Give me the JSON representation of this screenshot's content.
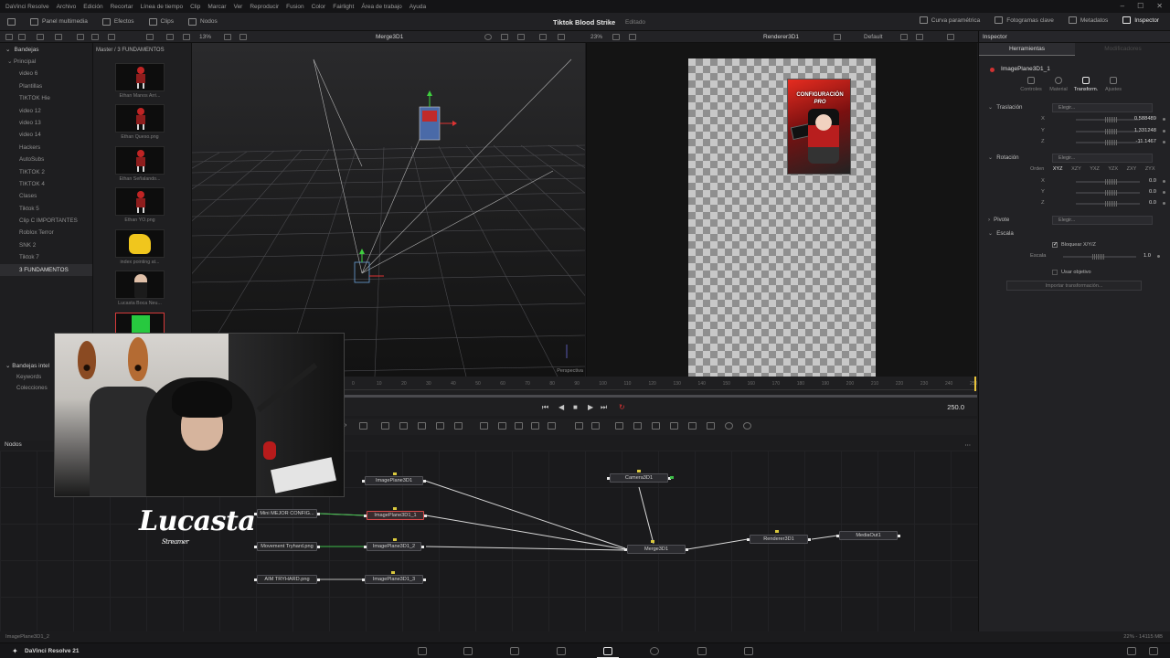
{
  "app": {
    "name": "DaVinci Resolve",
    "menu": [
      "Archivo",
      "Edición",
      "Recortar",
      "Línea de tiempo",
      "Clip",
      "Marcar",
      "Ver",
      "Reproducir",
      "Fusion",
      "Color",
      "Fairlight",
      "Área de trabajo",
      "Ayuda"
    ],
    "project_title": "Tiktok Blood Strike",
    "project_status": "Editado",
    "bottom_label": "DaVinci Resolve 21"
  },
  "toolbar": {
    "media_pool": "Panel multimedia",
    "effects": "Efectos",
    "clips": "Clips",
    "nodes": "Nodos",
    "curve": "Curva paramétrica",
    "keyframes": "Fotogramas clave",
    "metadata": "Metadatos",
    "inspector": "Inspector"
  },
  "viewer_bar": {
    "zoom_left": "13%",
    "left_title": "Merge3D1",
    "zoom_right": "23%",
    "right_title": "Renderer3D1",
    "preset": "Default",
    "inspector_label": "Inspector"
  },
  "bins": {
    "header": "Bandejas",
    "root": "Principal",
    "items": [
      "video 6",
      "Plantillas",
      "TIKTOK Hie",
      "video 12",
      "video 13",
      "video 14",
      "Hackers",
      "AutoSubs",
      "TIKTOK 2",
      "TIKTOK 4",
      "Clases",
      "Tiktok 5",
      "Clip C IMPORTANTES",
      "Roblox Terror",
      "SNK 2",
      "Tiktok 7",
      "3 FUNDAMENTOS"
    ],
    "selected": "3 FUNDAMENTOS",
    "smart_header": "Bandejas intel",
    "smart_items": [
      "Keywords",
      "Colecciones"
    ]
  },
  "media": {
    "path": "Master / 3 FUNDAMENTOS",
    "clips": [
      "Ethan Manos Arri...",
      "Ethan Queso.png",
      "Ethan Señalando...",
      "Ethan YO.png",
      "index pointing at...",
      "Lucasta Boca Neu...",
      ""
    ]
  },
  "viewer_left": {
    "label": "Perspectiva"
  },
  "viewer_right": {
    "thumbnail_line1": "CONFIGURACIÓN",
    "thumbnail_line2": "PRO"
  },
  "inspector": {
    "tab_tools": "Herramientas",
    "tab_modifiers": "Modificadores",
    "node_name": "ImagePlane3D1_1",
    "subtabs": [
      "Controles",
      "Material",
      "Transform.",
      "Ajustes"
    ],
    "active_subtab": "Transform.",
    "translation": {
      "label": "Traslación",
      "choose": "Elegir...",
      "x": "0.588489",
      "y": "1.331248",
      "z": "-11.1467"
    },
    "rotation": {
      "label": "Rotación",
      "choose": "Elegir...",
      "order_label": "Orden",
      "orders": [
        "XYZ",
        "XZY",
        "YXZ",
        "YZX",
        "ZXY",
        "ZYX"
      ],
      "x": "0.0",
      "y": "0.0",
      "z": "0.0"
    },
    "pivot": {
      "label": "Pivote",
      "choose": "Elegir..."
    },
    "scale": {
      "label": "Escala",
      "lock": "Bloquear X/Y/Z",
      "scale_label": "Escala",
      "value": "1.0"
    },
    "target": "Usar objetivo",
    "import": "Importar transformación..."
  },
  "timeline": {
    "ticks": [
      "0",
      "10",
      "20",
      "30",
      "40",
      "50",
      "60",
      "70",
      "80",
      "90",
      "100",
      "110",
      "120",
      "130",
      "140",
      "150",
      "160",
      "170",
      "180",
      "190",
      "200",
      "210",
      "220",
      "230",
      "240",
      "250"
    ],
    "end_frame": "250.0"
  },
  "nodes": {
    "header": "Nodos",
    "list": [
      {
        "id": "imgplane",
        "label": "ImagePlane3D1"
      },
      {
        "id": "mini",
        "label": "Mini MEJOR CONFIG..."
      },
      {
        "id": "imgplane1",
        "label": "ImagePlane3D1_1"
      },
      {
        "id": "movement",
        "label": "Movement Tryhard.png"
      },
      {
        "id": "imgplane2",
        "label": "ImagePlane3D1_2"
      },
      {
        "id": "aim",
        "label": "AIM TRYHARD.png"
      },
      {
        "id": "imgplane3",
        "label": "ImagePlane3D1_3"
      },
      {
        "id": "camera",
        "label": "Camera3D1"
      },
      {
        "id": "merge",
        "label": "Merge3D1"
      },
      {
        "id": "renderer",
        "label": "Renderer3D1"
      },
      {
        "id": "mediaout",
        "label": "MediaOut1"
      }
    ]
  },
  "status": {
    "left": "ImagePlane3D1_2",
    "right": "22% - 14115 MB"
  },
  "overlay": {
    "logo_text": "Lucasta",
    "logo_sub": "Streamer"
  }
}
